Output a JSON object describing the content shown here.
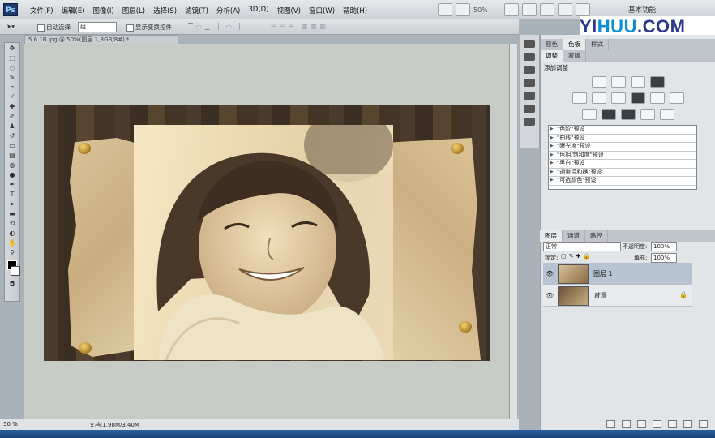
{
  "app": {
    "logo_text": "Ps",
    "workspace": "基本功能"
  },
  "menu": [
    "文件(F)",
    "编辑(E)",
    "图像(I)",
    "图层(L)",
    "选择(S)",
    "滤镜(T)",
    "分析(A)",
    "3D(D)",
    "视图(V)",
    "窗口(W)",
    "帮助(H)"
  ],
  "menubar_tools": {
    "zoom": "50%"
  },
  "options": {
    "auto_select": "自动选择",
    "auto_select_value": "组",
    "show_transform": "显示变换控件"
  },
  "document": {
    "tab_title": "5.6.1B.jpg @ 50%(图层 1,RGB/8#) *",
    "status_zoom": "50 %",
    "status_doc": "文档:1.98M/3.40M"
  },
  "watermark": {
    "part1": "YI",
    "part2": "HUU",
    "part3": ".COM"
  },
  "adjust_panel": {
    "tabs": [
      "调整",
      "蒙版"
    ],
    "title": "添加调整",
    "presets": [
      "\"色阶\"预设",
      "\"曲线\"预设",
      "\"曝光度\"预设",
      "\"色相/饱和度\"预设",
      "\"黑白\"预设",
      "\"通道混和器\"预设",
      "\"可选颜色\"预设"
    ]
  },
  "top_panel_tabs": [
    "颜色",
    "色板",
    "样式"
  ],
  "layers_panel": {
    "tabs": [
      "图层",
      "通道",
      "路径"
    ],
    "blend_mode": "正常",
    "opacity_label": "不透明度:",
    "opacity_value": "100%",
    "lock_label": "锁定:",
    "fill_label": "填充:",
    "fill_value": "100%",
    "layers": [
      {
        "name": "图层 1",
        "active": true
      },
      {
        "name": "背景",
        "active": false
      }
    ]
  },
  "colors": {
    "menubar": "#d9dde1",
    "canvas_bg": "#c7cbc5",
    "accent": "#1d3c6e"
  }
}
